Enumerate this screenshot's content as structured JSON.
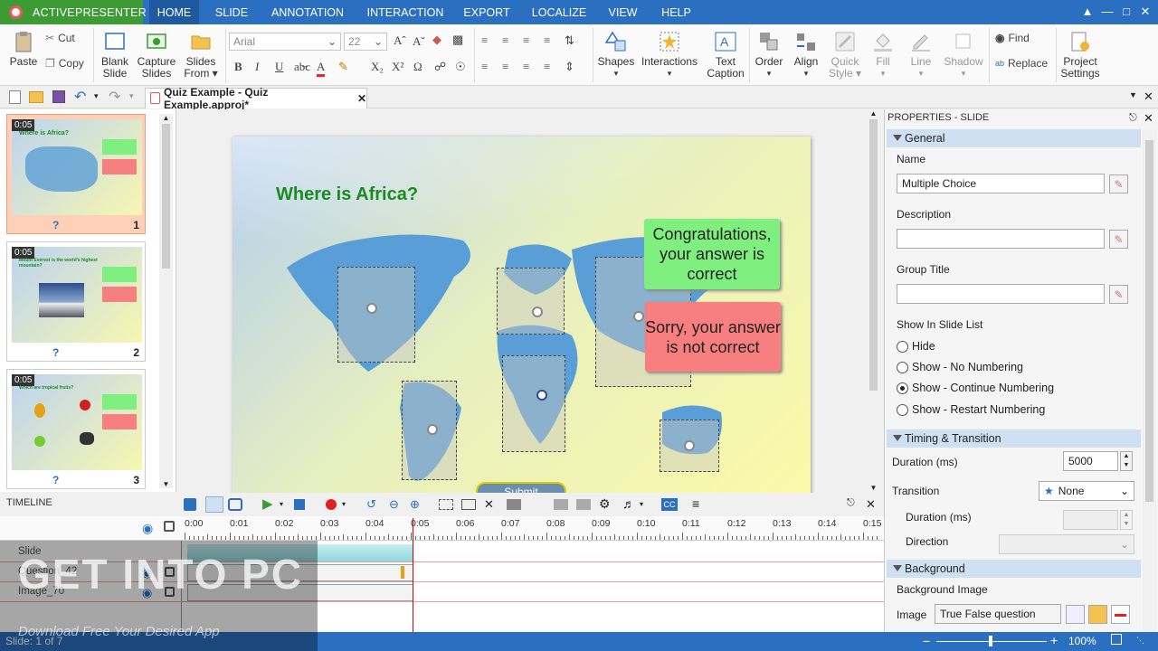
{
  "app": {
    "name": "ACTIVEPRESENTER"
  },
  "menu": {
    "tabs": [
      "HOME",
      "SLIDE",
      "ANNOTATION",
      "INTERACTION",
      "EXPORT",
      "LOCALIZE",
      "VIEW",
      "HELP"
    ],
    "active": "HOME"
  },
  "ribbon": {
    "paste": "Paste",
    "cut": "Cut",
    "copy": "Copy",
    "blank_slide": [
      "Blank",
      "Slide"
    ],
    "capture_slides": [
      "Capture",
      "Slides"
    ],
    "slides_from": [
      "Slides",
      "From"
    ],
    "font": "Arial",
    "font_size": "22",
    "shapes": "Shapes",
    "interactions": "Interactions",
    "text_caption": [
      "Text",
      "Caption"
    ],
    "order": "Order",
    "align": "Align",
    "quick_style": [
      "Quick",
      "Style"
    ],
    "fill": "Fill",
    "line": "Line",
    "shadow": "Shadow",
    "find": "Find",
    "replace": "Replace",
    "project_settings": [
      "Project",
      "Settings"
    ]
  },
  "document": {
    "tab_title": "Quiz Example - Quiz Example.approj*"
  },
  "slides": [
    {
      "duration": "0:05",
      "number": "1",
      "mark": "?",
      "title": "Where is Africa?"
    },
    {
      "duration": "0:05",
      "number": "2",
      "mark": "?",
      "title": "Mount Everest is the world's highest mountain?"
    },
    {
      "duration": "0:05",
      "number": "3",
      "mark": "?",
      "title": "Which are tropical fruits?"
    }
  ],
  "canvas": {
    "title": "Where is Africa?",
    "correct_msg": "Congratulations, your answer is correct",
    "incorrect_msg": "Sorry, your answer is not correct",
    "submit": "Submit"
  },
  "timeline": {
    "title": "TIMELINE",
    "ticks": [
      "0:00",
      "0:01",
      "0:02",
      "0:03",
      "0:04",
      "0:05",
      "0:06",
      "0:07",
      "0:08",
      "0:09",
      "0:10",
      "0:11",
      "0:12",
      "0:13",
      "0:14",
      "0:15"
    ],
    "rows": [
      "Slide",
      "Question_42",
      "Image_70"
    ]
  },
  "properties": {
    "header": "PROPERTIES - SLIDE",
    "general": "General",
    "name_label": "Name",
    "name_value": "Multiple Choice",
    "description_label": "Description",
    "description_value": "",
    "group_title_label": "Group Title",
    "group_title_value": "",
    "show_in_list_label": "Show In Slide List",
    "options": [
      "Hide",
      "Show - No Numbering",
      "Show - Continue Numbering",
      "Show - Restart Numbering"
    ],
    "selected_option": "Show - Continue Numbering",
    "timing": "Timing & Transition",
    "duration_label": "Duration (ms)",
    "duration_value": "5000",
    "transition_label": "Transition",
    "transition_value": "None",
    "tr_duration_label": "Duration (ms)",
    "direction_label": "Direction",
    "background": "Background",
    "bg_image_label": "Background Image",
    "image_label": "Image",
    "image_value": "True False question"
  },
  "status": {
    "slide": "Slide: 1 of 7",
    "zoom": "100%"
  },
  "watermark": {
    "line1": "GET INTO PC",
    "line2": "Download Free Your Desired App"
  },
  "colors": {
    "menubar": "#2b6fc0",
    "app_green": "#3d9b35",
    "correct": "#7ff07f",
    "incorrect": "#f87f7f"
  }
}
